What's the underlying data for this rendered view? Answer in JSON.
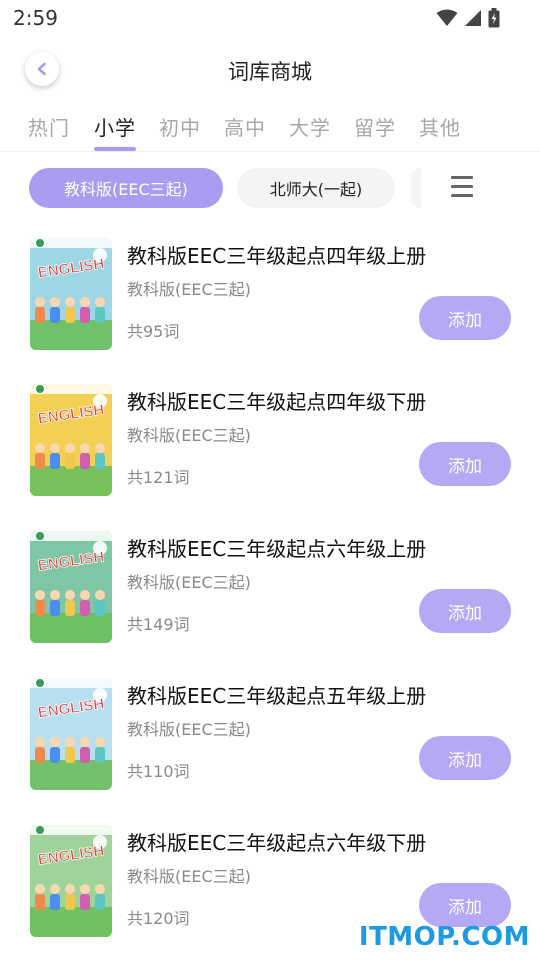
{
  "status_bar": {
    "time": "2:59"
  },
  "header": {
    "title": "词库商城"
  },
  "tabs": [
    {
      "label": "热门"
    },
    {
      "label": "小学",
      "active": true
    },
    {
      "label": "初中"
    },
    {
      "label": "高中"
    },
    {
      "label": "大学"
    },
    {
      "label": "留学"
    },
    {
      "label": "其他"
    }
  ],
  "filters": {
    "chips": [
      {
        "label": "教科版(EEC三起)",
        "active": true
      },
      {
        "label": "北师大(一起)"
      }
    ]
  },
  "books": [
    {
      "title": "教科版EEC三年级起点四年级上册",
      "edition": "教科版(EEC三起)",
      "count": "共95词",
      "add_label": "添加",
      "cover_color": "#9ed6e6"
    },
    {
      "title": "教科版EEC三年级起点四年级下册",
      "edition": "教科版(EEC三起)",
      "count": "共121词",
      "add_label": "添加",
      "cover_color": "#f3cf55"
    },
    {
      "title": "教科版EEC三年级起点六年级上册",
      "edition": "教科版(EEC三起)",
      "count": "共149词",
      "add_label": "添加",
      "cover_color": "#7fc6a4"
    },
    {
      "title": "教科版EEC三年级起点五年级上册",
      "edition": "教科版(EEC三起)",
      "count": "共110词",
      "add_label": "添加",
      "cover_color": "#b7dff0"
    },
    {
      "title": "教科版EEC三年级起点六年级下册",
      "edition": "教科版(EEC三起)",
      "count": "共120词",
      "add_label": "添加",
      "cover_color": "#9fd39a"
    }
  ],
  "cover_text": "ENGLISH",
  "watermark": "ITMOP.COM",
  "colors": {
    "accent": "#a99cf2",
    "button": "#b5a9f5",
    "watermark": "#1c9be0"
  }
}
